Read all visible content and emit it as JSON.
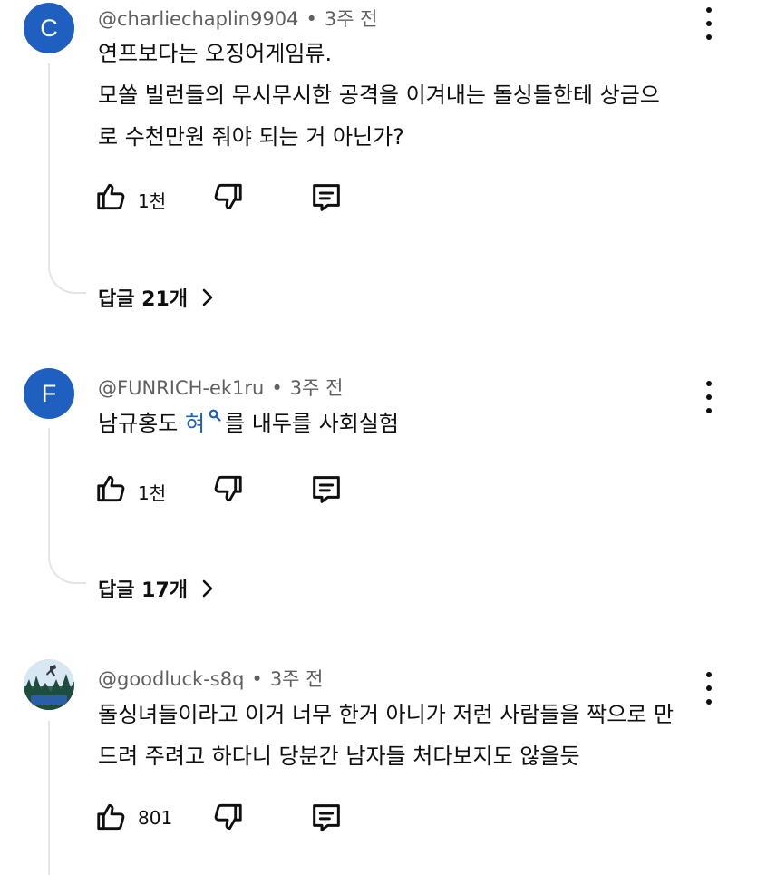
{
  "colors": {
    "avatar_c": "#1f5fbf",
    "avatar_f": "#1f5fbf",
    "link": "#1a5fc4",
    "meta": "#606060"
  },
  "comments": [
    {
      "avatar_letter": "C",
      "handle": "@charliechaplin9904",
      "time": "3주 전",
      "lines": [
        "연프보다는 오징어게임류.",
        "모쏠 빌런들의 무시무시한 공격을 이겨내는 돌싱들한테 상금으",
        "로 수천만원 줘야 되는 거 아닌가?"
      ],
      "likes": "1천",
      "replies": "답글 21개"
    },
    {
      "avatar_letter": "F",
      "handle": "@FUNRICH-ek1ru",
      "time": "3주 전",
      "text_before": "남규홍도 ",
      "link_text": "혀",
      "text_after": "를 내두를 사회실험",
      "likes": "1천",
      "replies": "답글 17개"
    },
    {
      "avatar_icon": "landscape-avatar",
      "handle": "@goodluck-s8q",
      "time": "3주 전",
      "lines": [
        "돌싱녀들이라고 이거 너무 한거 아니가 저런 사람들을 짝으로 만",
        "드려 주려고 하다니 당분간 남자들 처다보지도 않을듯"
      ],
      "likes": "801"
    }
  ],
  "icons": {
    "like": "thumbs-up-icon",
    "dislike": "thumbs-down-icon",
    "reply": "comment-icon",
    "more": "more-vertical-icon",
    "chevron": "chevron-right-icon",
    "search": "search-icon"
  }
}
